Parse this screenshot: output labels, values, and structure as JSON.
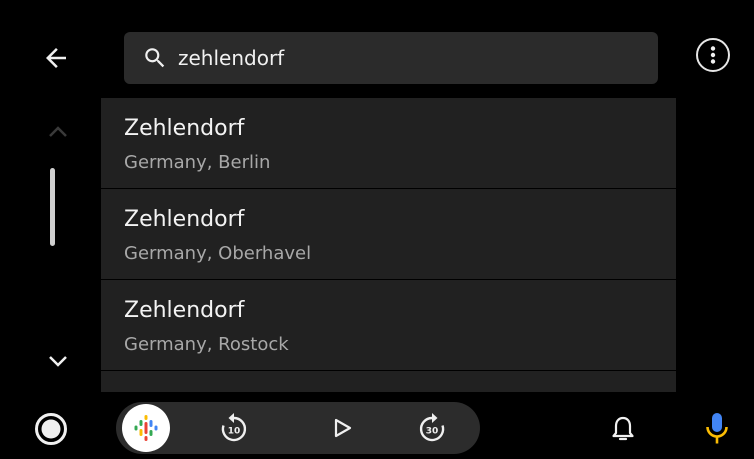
{
  "search": {
    "query": "zehlendorf",
    "placeholder": ""
  },
  "results": [
    {
      "title": "Zehlendorf",
      "subtitle": "Germany, Berlin"
    },
    {
      "title": "Zehlendorf",
      "subtitle": "Germany, Oberhavel"
    },
    {
      "title": "Zehlendorf",
      "subtitle": "Germany, Rostock"
    }
  ],
  "media": {
    "rewind_seconds": "10",
    "forward_seconds": "30"
  },
  "icons": {
    "back": "arrow-left-icon",
    "search": "search-icon",
    "menu": "more-vertical-icon",
    "scroll_up": "chevron-up-icon",
    "scroll_down": "chevron-down-icon",
    "home": "home-circle-icon",
    "podcast": "podcast-app-icon",
    "rewind": "replay-10-icon",
    "play": "play-icon",
    "forward": "forward-30-icon",
    "notifications": "bell-icon",
    "mic": "microphone-icon"
  },
  "colors": {
    "background": "#000000",
    "search_box": "#2b2b2b",
    "list_item": "#212121",
    "divider": "#3e3e3e",
    "media_pill": "#2c2c2c",
    "text_primary": "#f3f3f3",
    "text_secondary": "#a8a8a8",
    "mic_blue": "#4285f4",
    "mic_orange": "#fbbc04"
  }
}
